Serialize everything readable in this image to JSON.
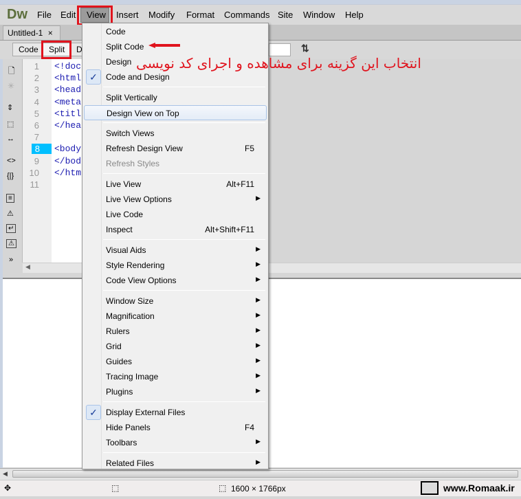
{
  "app": {
    "logo": "Dw"
  },
  "menubar": [
    "File",
    "Edit",
    "View",
    "Insert",
    "Modify",
    "Format",
    "Commands",
    "Site",
    "Window",
    "Help"
  ],
  "document_tab": {
    "title": "Untitled-1",
    "close": "×"
  },
  "toolbar": {
    "code": "Code",
    "split": "Split",
    "design": "D"
  },
  "line_numbers": [
    "1",
    "2",
    "3",
    "4",
    "5",
    "6",
    "7",
    "8",
    "9",
    "10",
    "11"
  ],
  "current_line": "8",
  "code_lines": [
    "<!doc",
    "<html",
    "<head",
    "<meta",
    "<titl",
    "</hea",
    "",
    "<body",
    "</bod",
    "</htm",
    ""
  ],
  "view_menu": [
    {
      "label": "Code"
    },
    {
      "label": "Split Code"
    },
    {
      "label": "Design"
    },
    {
      "label": "Code and Design",
      "checked": true
    },
    {
      "sep": true
    },
    {
      "label": "Split Vertically"
    },
    {
      "label": "Design View on Top",
      "highlighted": true
    },
    {
      "sep": true
    },
    {
      "label": "Switch Views"
    },
    {
      "label": "Refresh Design View",
      "shortcut": "F5"
    },
    {
      "label": "Refresh Styles",
      "disabled": true
    },
    {
      "sep": true
    },
    {
      "label": "Live View",
      "shortcut": "Alt+F11"
    },
    {
      "label": "Live View Options",
      "submenu": true
    },
    {
      "label": "Live Code"
    },
    {
      "label": "Inspect",
      "shortcut": "Alt+Shift+F11"
    },
    {
      "sep": true
    },
    {
      "label": "Visual Aids",
      "submenu": true
    },
    {
      "label": "Style Rendering",
      "submenu": true
    },
    {
      "label": "Code View Options",
      "submenu": true
    },
    {
      "sep": true
    },
    {
      "label": "Window Size",
      "submenu": true
    },
    {
      "label": "Magnification",
      "submenu": true
    },
    {
      "label": "Rulers",
      "submenu": true
    },
    {
      "label": "Grid",
      "submenu": true
    },
    {
      "label": "Guides",
      "submenu": true
    },
    {
      "label": "Tracing Image",
      "submenu": true
    },
    {
      "label": "Plugins",
      "submenu": true
    },
    {
      "sep": true
    },
    {
      "label": "Display External Files",
      "checked": true
    },
    {
      "label": "Hide Panels",
      "shortcut": "F4"
    },
    {
      "label": "Toolbars",
      "submenu": true
    },
    {
      "sep": true
    },
    {
      "label": "Related Files",
      "submenu": true
    }
  ],
  "annotation": "انتخاب این گزینه برای  مشاهده و اجرای کد نویسی",
  "status": {
    "size": "1600 × 1766px",
    "watermark": "www.Romaak.ir"
  },
  "colors": {
    "highlight_red": "#e0141e",
    "current_line": "#00bfff",
    "code_text": "#1a1ab0"
  }
}
